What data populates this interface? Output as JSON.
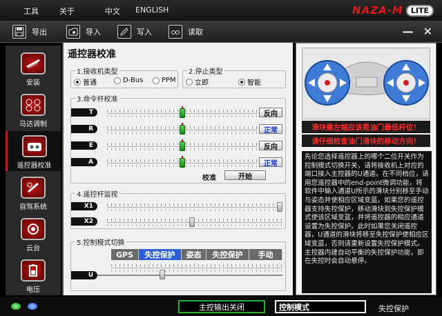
{
  "menu": {
    "tools": "工具",
    "about": "关于",
    "chinese": "中文",
    "english": "ENGLISH",
    "logo_main": "NAZA-M",
    "logo_badge": "LITE"
  },
  "toolbar": {
    "export": "导出",
    "import": "导入",
    "write": "写入",
    "read": "读取"
  },
  "sidebar": {
    "items": [
      {
        "label": "安装",
        "icon": "rotor-icon"
      },
      {
        "label": "马达调制",
        "icon": "motor-icon"
      },
      {
        "label": "遥控器校准",
        "icon": "remote-icon"
      },
      {
        "label": "自驾系统",
        "icon": "autopilot-icon"
      },
      {
        "label": "云台",
        "icon": "gimbal-icon"
      },
      {
        "label": "电压",
        "icon": "battery-icon"
      }
    ],
    "active_index": 2
  },
  "main": {
    "title": "遥控器校准",
    "receiver": {
      "label": "1.接收机类型",
      "options": [
        "普通",
        "D-Bus",
        "PPM"
      ],
      "selected": "普通"
    },
    "stop": {
      "label": "2.停止类型",
      "options": [
        "立即",
        "智能"
      ],
      "selected": "智能"
    },
    "sticks": {
      "label": "3.命令杆校准",
      "channels": [
        {
          "name": "T",
          "value": 0.5,
          "button": "反向"
        },
        {
          "name": "R",
          "value": 0.5,
          "button": "正常"
        },
        {
          "name": "E",
          "value": 0.5,
          "button": "反向"
        },
        {
          "name": "A",
          "value": 0.5,
          "button": "正常"
        }
      ],
      "calib_label": "校准",
      "start_button": "开始"
    },
    "monitor": {
      "label": "4.遥控杆监视",
      "channels": [
        {
          "name": "X1",
          "value": 1.0
        },
        {
          "name": "X2",
          "value": 0.5
        }
      ]
    },
    "mode": {
      "label": "5.控制模式切换",
      "segments": [
        "GPS",
        "失控保护",
        "姿态",
        "失控保护",
        "手动"
      ],
      "highlight_index": 1,
      "channel": "U",
      "value": 0.3
    }
  },
  "right": {
    "warning1": "滑块最左端应该是油门最低杆位！",
    "warning2": "请仔细检查油门滑块的移动方向！",
    "description": "先论您选择遥控器上的哪个二位开关作为控制模式切换开关，请将接收机上对应的端口接入主控器的U通道。在不同档位，请用您遥控器中的end-point微调功能，将软件中输入通道U所示的滑块分别移至手动与姿态并使相应区域变蓝。如果您的遥控器支持失控保护，移动滑块到失控保护模式使该区域变蓝，并将遥控器的相应通道设置为失控保护。此时如果您关闭遥控器，U通道的滑块将移至失控保护使相应区域变蓝，否则请重新设置失控保护模式。主控器内建自动平衡的失控保护功能，即在失控时会自动悬停。"
  },
  "status": {
    "output": "主控输出关闭",
    "mode_label": "控制模式",
    "mode_value": "失控保护"
  },
  "colors": {
    "accent_red": "#c61a1a",
    "slider_green": "#1aa01a",
    "mode_highlight": "#2a5fd8"
  }
}
